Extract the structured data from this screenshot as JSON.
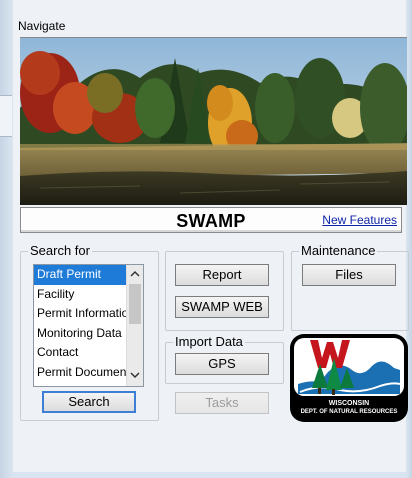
{
  "window": {
    "title": "Navigate"
  },
  "banner": {
    "title": "SWAMP",
    "link": "New Features"
  },
  "search": {
    "group_label": "Search for",
    "items": [
      "Draft Permit",
      "Facility",
      "Permit Information",
      "Monitoring Data",
      "Contact",
      "Permit Documents"
    ],
    "selected_index": 0,
    "button": "Search"
  },
  "actions": {
    "report": "Report",
    "swamp_web": "SWAMP WEB"
  },
  "import_data": {
    "group_label": "Import Data",
    "gps": "GPS",
    "tasks": "Tasks"
  },
  "maintenance": {
    "group_label": "Maintenance",
    "files": "Files"
  },
  "logo": {
    "text_line1": "WISCONSIN",
    "text_line2": "DEPT. OF NATURAL RESOURCES"
  },
  "colors": {
    "selection": "#1e7cd8",
    "link": "#0e24a8",
    "focus": "#3c7fd4"
  },
  "icons": {
    "scroll_up": "chevron-up-icon",
    "scroll_down": "chevron-down-icon"
  }
}
